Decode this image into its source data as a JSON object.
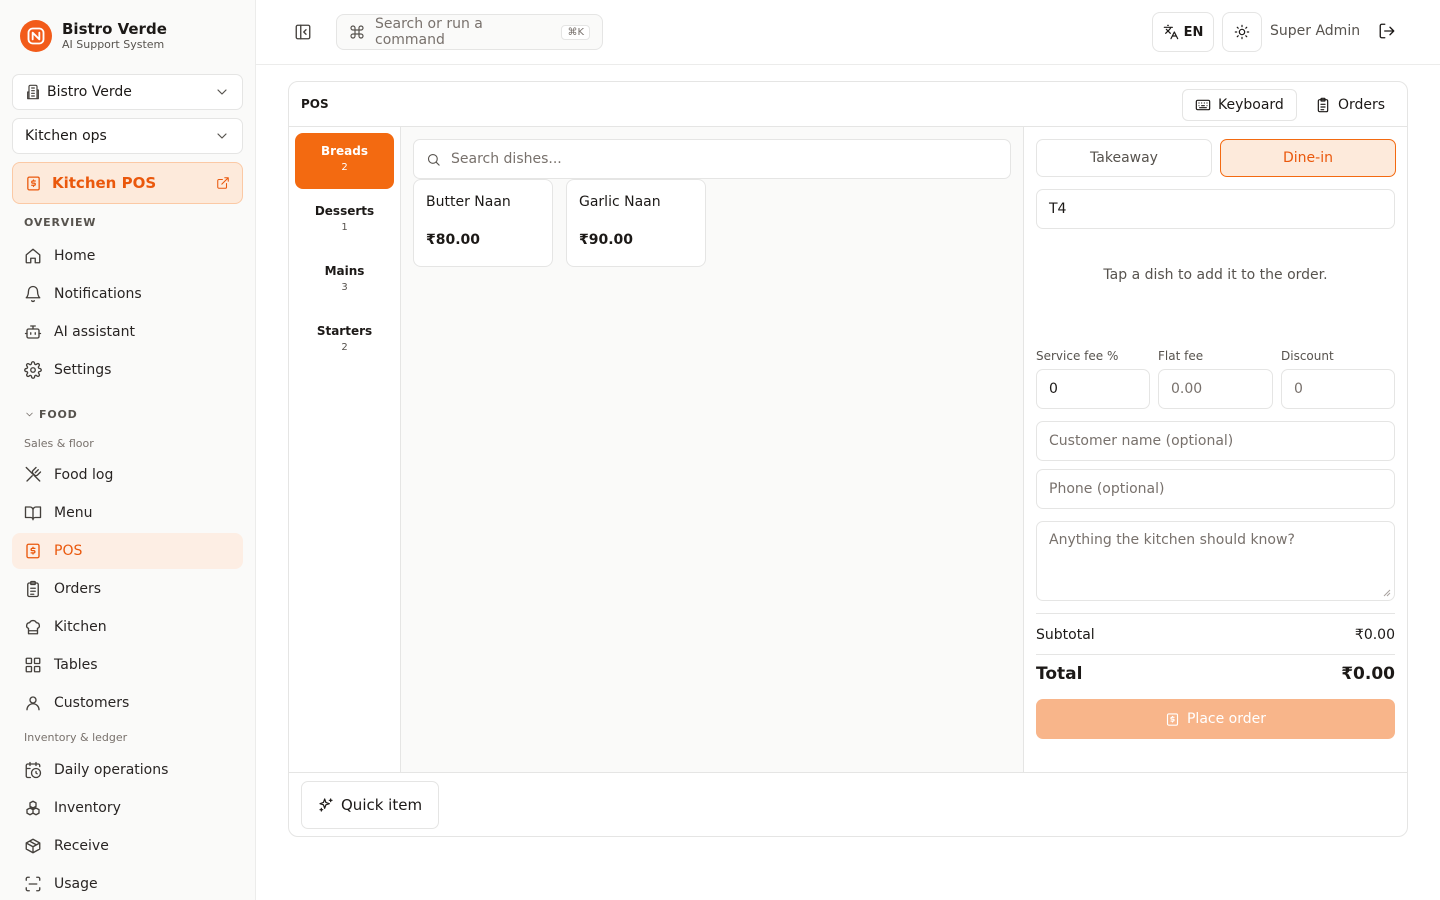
{
  "brand": {
    "name": "Bistro Verde",
    "subtitle": "AI Support System"
  },
  "sidebar": {
    "restaurant_select": "Bistro Verde",
    "workspace_select": "Kitchen ops",
    "kitchen_pos": "Kitchen POS",
    "overview_label": "OVERVIEW",
    "overview_items": [
      "Home",
      "Notifications",
      "AI assistant",
      "Settings"
    ],
    "food_label": "FOOD",
    "sales_label": "Sales & floor",
    "sales_items": [
      "Food log",
      "Menu",
      "POS",
      "Orders",
      "Kitchen",
      "Tables",
      "Customers"
    ],
    "inventory_label": "Inventory & ledger",
    "inventory_items": [
      "Daily operations",
      "Inventory",
      "Receive",
      "Usage"
    ],
    "active_item": "POS"
  },
  "topbar": {
    "search_placeholder": "Search or run a command",
    "shortcut": "⌘K",
    "language": "EN",
    "user": "Super Admin"
  },
  "pos": {
    "title": "POS",
    "keyboard_button": "Keyboard",
    "orders_button": "Orders",
    "categories": [
      {
        "name": "Breads",
        "count": "2"
      },
      {
        "name": "Desserts",
        "count": "1"
      },
      {
        "name": "Mains",
        "count": "3"
      },
      {
        "name": "Starters",
        "count": "2"
      }
    ],
    "search_placeholder": "Search dishes...",
    "dishes": [
      {
        "name": "Butter Naan",
        "price": "₹80.00"
      },
      {
        "name": "Garlic Naan",
        "price": "₹90.00"
      }
    ],
    "order": {
      "mode_takeaway": "Takeaway",
      "mode_dinein": "Dine-in",
      "selected_mode": "Dine-in",
      "table": "T4",
      "empty_hint": "Tap a dish to add it to the order.",
      "service_fee_label": "Service fee %",
      "service_fee_value": "0",
      "flat_fee_label": "Flat fee",
      "flat_fee_placeholder": "0.00",
      "discount_label": "Discount",
      "discount_placeholder": "0",
      "customer_placeholder": "Customer name (optional)",
      "phone_placeholder": "Phone (optional)",
      "notes_placeholder": "Anything the kitchen should know?",
      "subtotal_label": "Subtotal",
      "subtotal_value": "₹0.00",
      "total_label": "Total",
      "total_value": "₹0.00",
      "place_order": "Place order"
    },
    "quick_item": "Quick item"
  },
  "colors": {
    "accent": "#f36a11",
    "accent_soft": "#fdeadb",
    "disabled_accent": "#f8b58a"
  }
}
